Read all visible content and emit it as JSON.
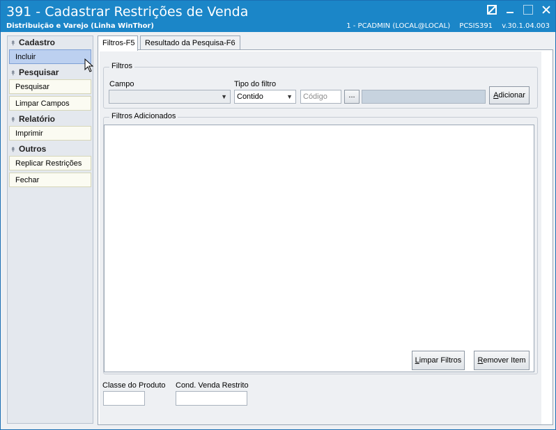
{
  "window": {
    "title": "391 - Cadastrar Restrições de Venda",
    "subtitle": "Distribuição e Varejo (Linha WinThor)",
    "session_user": "1 - PCADMIN (LOCAL@LOCAL)",
    "session_module": "PCSIS391",
    "session_version": "v.30.1.04.003"
  },
  "sidebar": {
    "groups": [
      {
        "title": "Cadastro",
        "items": [
          "Incluir"
        ]
      },
      {
        "title": "Pesquisar",
        "items": [
          "Pesquisar",
          "Limpar Campos"
        ]
      },
      {
        "title": "Relatório",
        "items": [
          "Imprimir"
        ]
      },
      {
        "title": "Outros",
        "items": [
          "Replicar Restrições",
          "Fechar"
        ]
      }
    ],
    "active_item": "Incluir"
  },
  "tabs": [
    {
      "label": "Filtros-F5",
      "active": true
    },
    {
      "label": "Resultado da Pesquisa-F6",
      "active": false
    }
  ],
  "filters": {
    "group_label": "Filtros",
    "campo_label": "Campo",
    "campo_value": "",
    "tipo_label": "Tipo do filtro",
    "tipo_value": "Contido",
    "codigo_placeholder": "Código",
    "ellipsis_label": "...",
    "add_button_prefix": "A",
    "add_button_rest": "dicionar"
  },
  "added_filters": {
    "group_label": "Filtros Adicionados",
    "items": [],
    "clear_button_prefix": "L",
    "clear_button_rest": "impar Filtros",
    "remove_button_prefix": "R",
    "remove_button_rest": "emover Item"
  },
  "bottom_fields": {
    "classe_label": "Classe do Produto",
    "classe_value": "",
    "cond_label": "Cond. Venda Restrito",
    "cond_value": ""
  },
  "colors": {
    "titlebar": "#1b86c8",
    "active_item": "#bcd0f0",
    "panel": "#eef0f3"
  }
}
